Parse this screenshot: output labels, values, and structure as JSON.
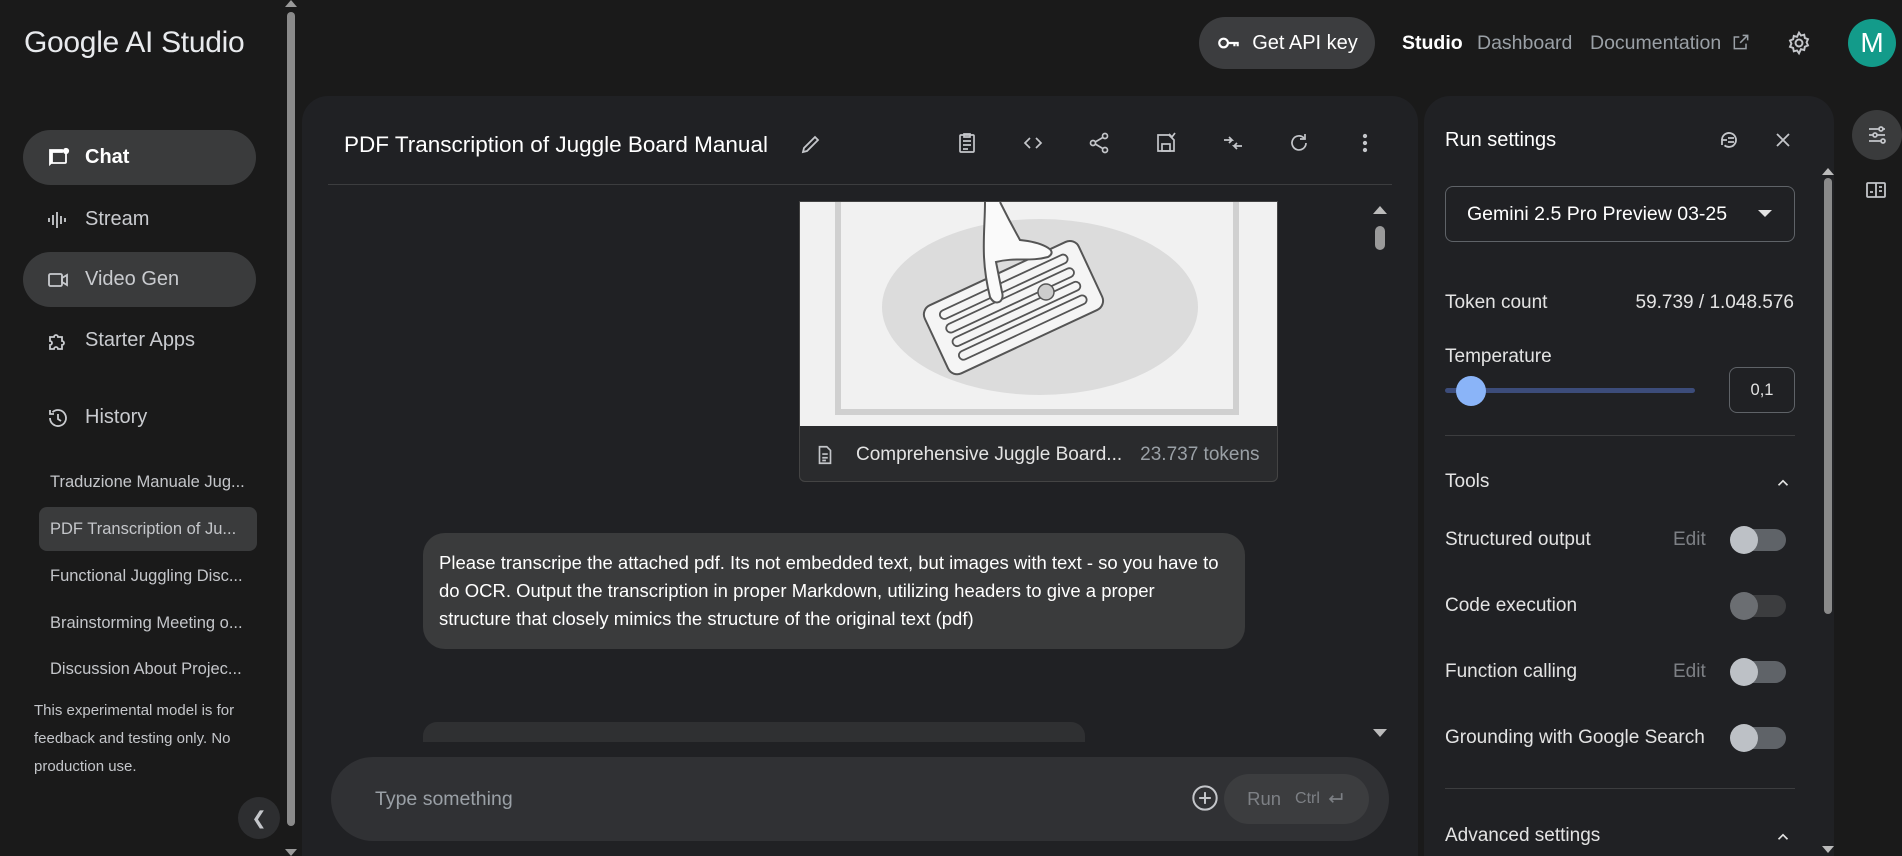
{
  "app": {
    "brand": "Google AI Studio"
  },
  "sidebar": {
    "nav": [
      {
        "label": "Chat",
        "icon": "chat-icon"
      },
      {
        "label": "Stream",
        "icon": "audio-wave-icon"
      },
      {
        "label": "Video Gen",
        "icon": "video-camera-icon"
      },
      {
        "label": "Starter Apps",
        "icon": "puzzle-icon"
      },
      {
        "label": "History",
        "icon": "history-icon"
      }
    ],
    "history": [
      "Traduzione Manuale Jug...",
      "PDF Transcription of Ju...",
      "Functional Juggling Disc...",
      "Brainstorming Meeting o...",
      "Discussion About Projec..."
    ],
    "disclaimer": "This experimental model is for feedback and testing only. No production use."
  },
  "topbar": {
    "api_key": "Get API key",
    "studio": "Studio",
    "dashboard": "Dashboard",
    "documentation": "Documentation",
    "avatar_initial": "M",
    "avatar_color": "#139b8a"
  },
  "chat": {
    "title": "PDF Transcription of Juggle Board Manual",
    "attachment": {
      "name": "Comprehensive Juggle Board...",
      "tokens": "23.737 tokens"
    },
    "message": "Please transcripe the attached pdf. Its not embedded text, but images with text - so you have to do OCR. Output the transcription in proper Markdown, utilizing headers to give a proper structure that closely mimics the structure of the original text (pdf)",
    "composer": {
      "placeholder": "Type something",
      "run": "Run",
      "shortcut": "Ctrl"
    }
  },
  "settings": {
    "title": "Run settings",
    "model": "Gemini 2.5 Pro Preview 03-25",
    "token_count_label": "Token count",
    "token_count_value": "59.739 / 1.048.576",
    "temperature_label": "Temperature",
    "temperature_value": "0,1",
    "temperature_fraction": 0.05,
    "tools_label": "Tools",
    "tools": [
      {
        "label": "Structured output",
        "edit": "Edit",
        "enabled": false
      },
      {
        "label": "Code execution",
        "edit": "",
        "enabled": false
      },
      {
        "label": "Function calling",
        "edit": "Edit",
        "enabled": false
      },
      {
        "label": "Grounding with Google Search",
        "edit": "",
        "enabled": false
      }
    ],
    "advanced_label": "Advanced settings",
    "accent_color": "#8ab4f8"
  }
}
